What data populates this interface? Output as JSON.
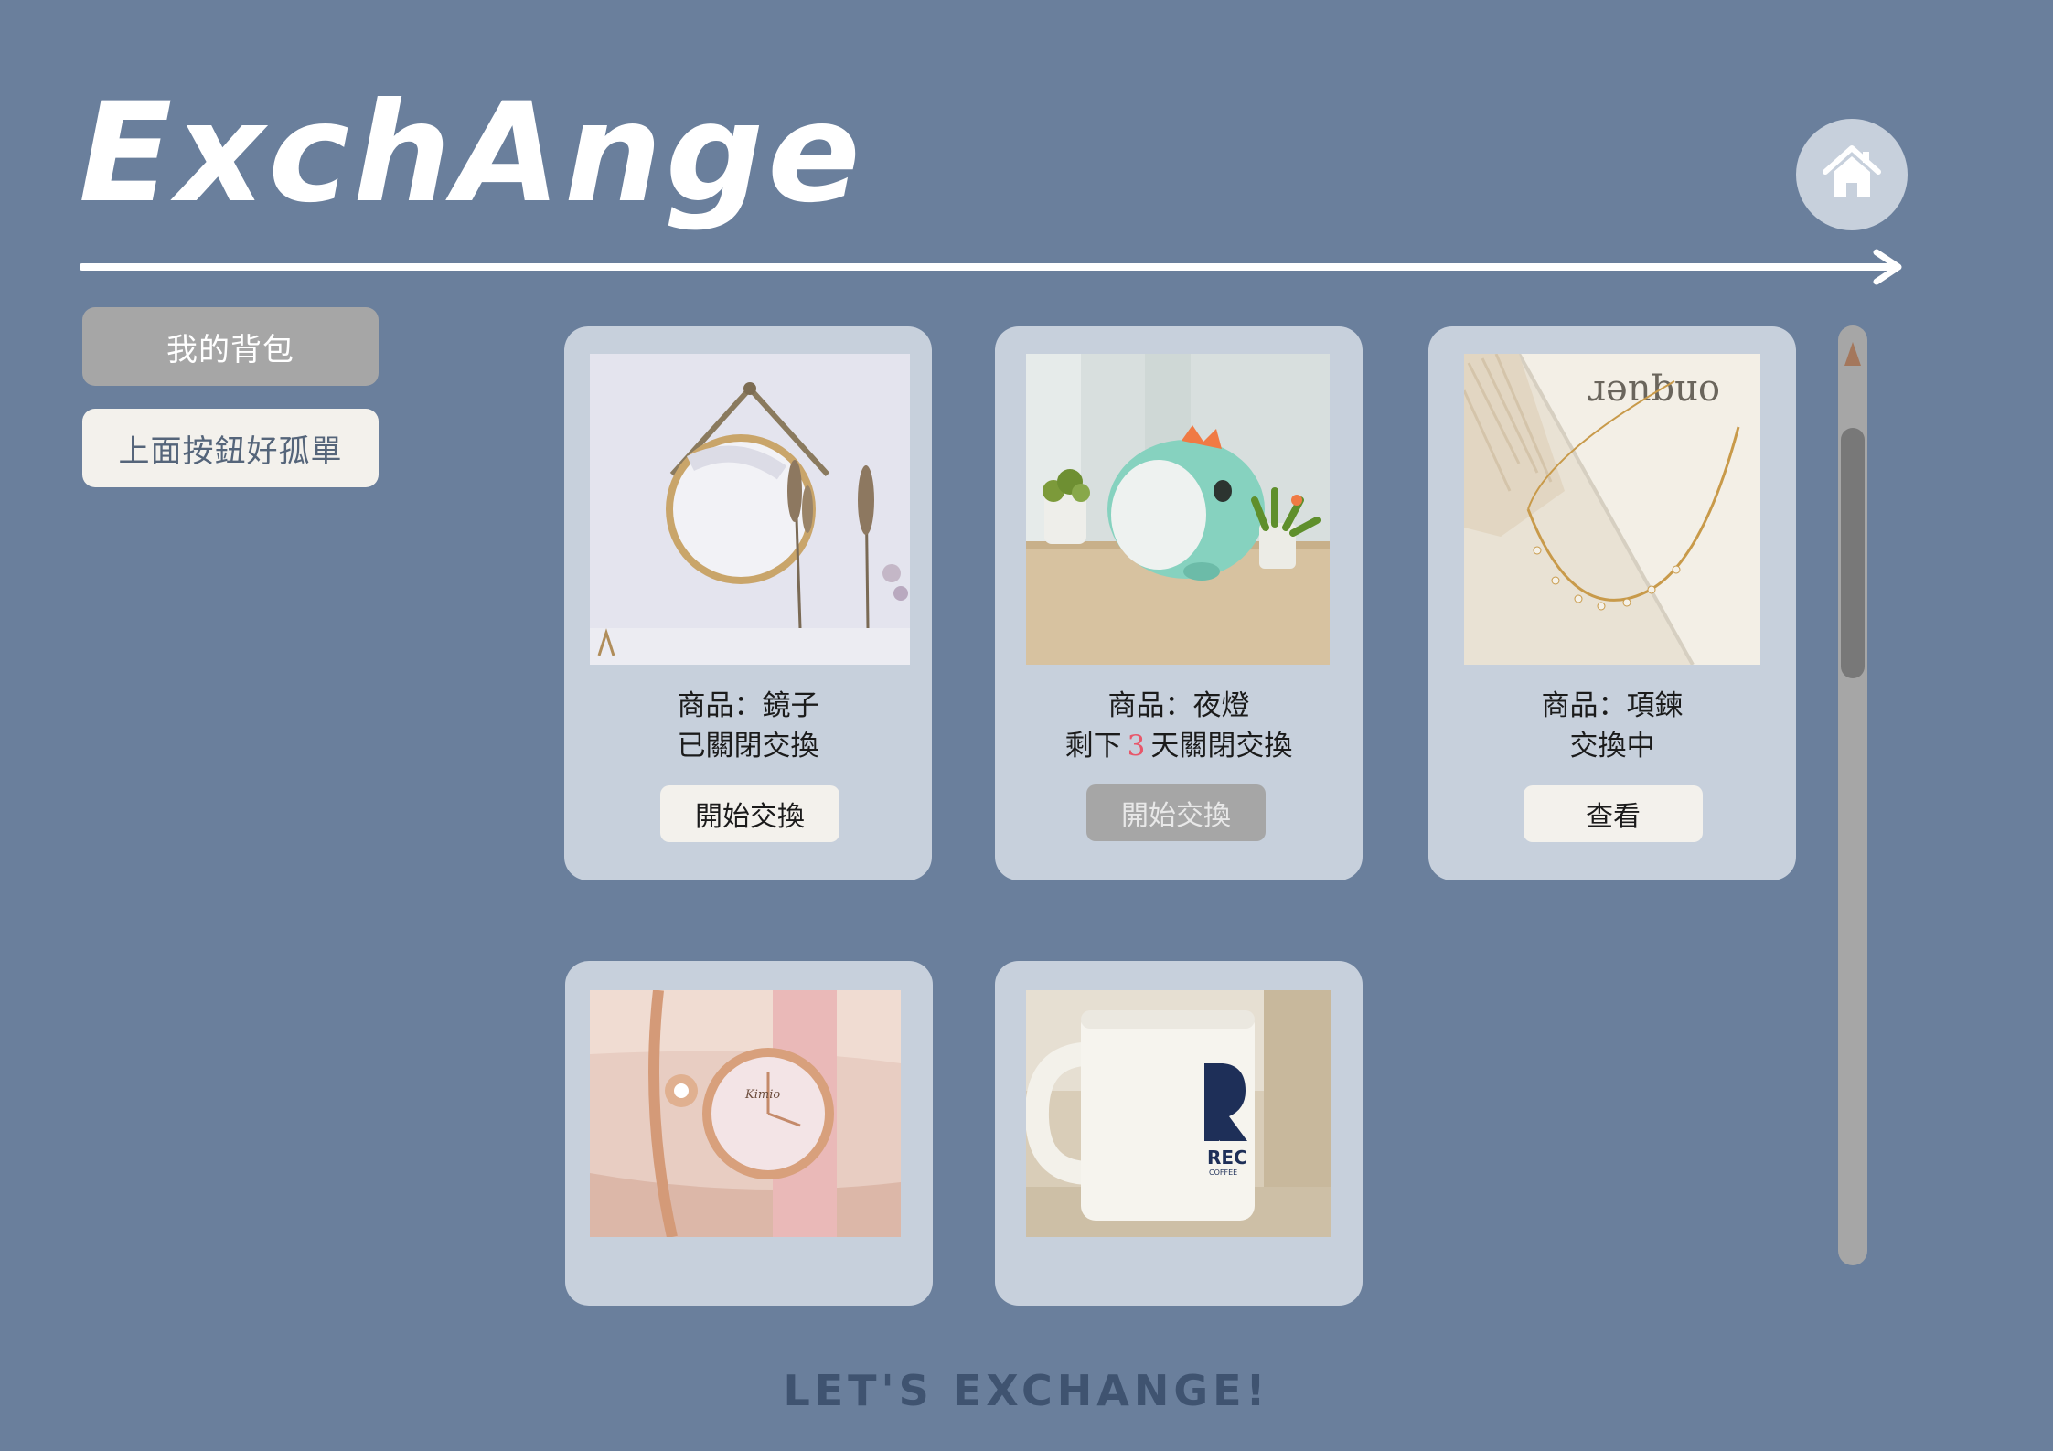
{
  "app": {
    "title": "ExchAnge"
  },
  "header": {
    "home_icon": "home-icon"
  },
  "sidebar": {
    "items": [
      {
        "label": "我的背包",
        "style": "gray"
      },
      {
        "label": "上面按鈕好孤單",
        "style": "light"
      }
    ]
  },
  "cards": [
    {
      "product": "商品：鏡子",
      "status": "已關閉交換",
      "button": "開始交換",
      "button_state": "enabled",
      "image": "round-mirror"
    },
    {
      "product": "商品：夜燈",
      "status_prefix": "剩下",
      "days_left": "3",
      "status_suffix": "天關閉交換",
      "button": "開始交換",
      "button_state": "disabled",
      "image": "dinosaur-night-light"
    },
    {
      "product": "商品：項鍊",
      "status": "交換中",
      "button": "查看",
      "button_state": "enabled",
      "image": "gold-necklace"
    },
    {
      "image": "rose-gold-watch"
    },
    {
      "image": "coffee-mug",
      "mug_text": "REC",
      "mug_subtext": "COFFEE"
    }
  ],
  "colors": {
    "background": "#6a7f9c",
    "card": "#c7d0dc",
    "button_light": "#f3f1ec",
    "button_gray": "#a6a6a6",
    "accent_days": "#e8576a"
  },
  "footer": {
    "text": "LET'S EXCHANGE!"
  }
}
